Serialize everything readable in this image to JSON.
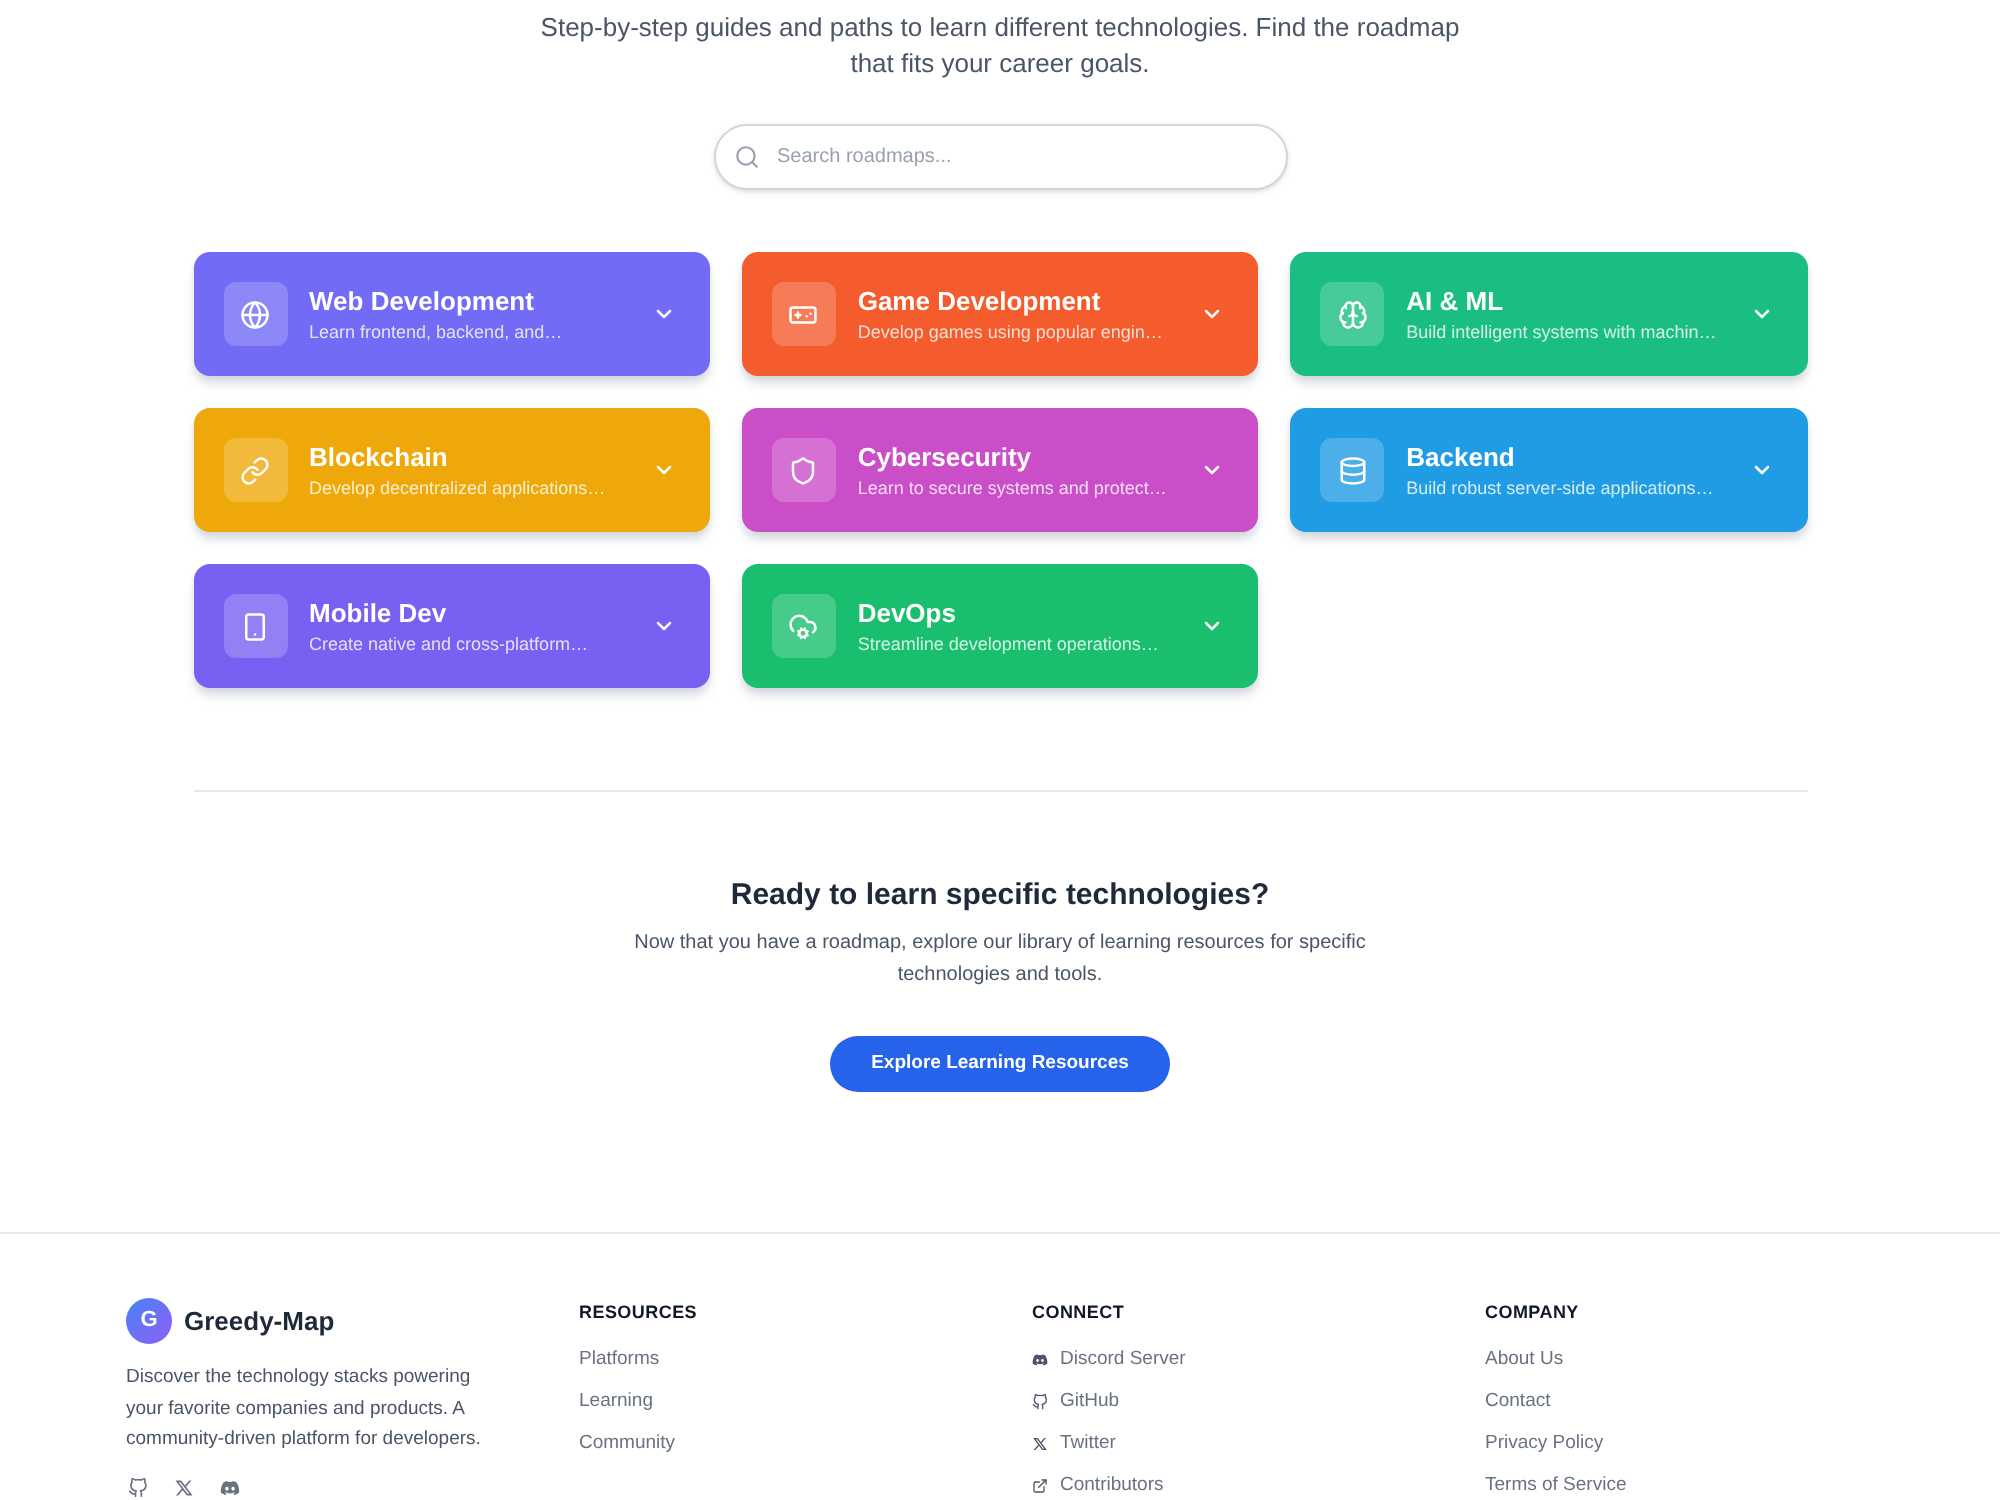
{
  "intro": {
    "text": "Step-by-step guides and paths to learn different technologies. Find the roadmap that fits your career goals."
  },
  "search": {
    "placeholder": "Search roadmaps..."
  },
  "roadmaps": [
    {
      "title": "Web Development",
      "description": "Learn frontend, backend, and…",
      "color": "#716bf6",
      "expanded": false
    },
    {
      "title": "Game Development",
      "description": "Develop games using popular engin…",
      "color": "#f45b2d",
      "expanded": false
    },
    {
      "title": "AI & ML",
      "description": "Build intelligent systems with machin…",
      "color": "#1bbe82",
      "expanded": false
    },
    {
      "title": "Blockchain",
      "description": "Develop decentralized applications…",
      "color": "#efa809",
      "expanded": false
    },
    {
      "title": "Cybersecurity",
      "description": "Learn to secure systems and protect…",
      "color": "#ca4ec8",
      "expanded": false
    },
    {
      "title": "Backend",
      "description": "Build robust server-side applications…",
      "color": "#209ce5",
      "expanded": false
    },
    {
      "title": "Mobile Dev",
      "description": "Create native and cross-platform…",
      "color": "#7761f3",
      "expanded": false
    },
    {
      "title": "DevOps",
      "description": "Streamline development operations…",
      "color": "#19bf6f",
      "expanded": false
    }
  ],
  "cta": {
    "heading": "Ready to learn specific technologies?",
    "text": "Now that you have a roadmap, explore our library of learning resources for specific technologies and tools.",
    "button": "Explore Learning Resources"
  },
  "footer": {
    "brand": {
      "logo_letter": "G",
      "name": "Greedy-Map",
      "description": "Discover the technology stacks powering your favorite companies and products. A community-driven platform for developers."
    },
    "columns": [
      {
        "heading": "RESOURCES",
        "kind": "plain",
        "links": [
          "Platforms",
          "Learning",
          "Community"
        ]
      },
      {
        "heading": "CONNECT",
        "kind": "with_icons",
        "links": [
          "Discord Server",
          "GitHub",
          "Twitter",
          "Contributors"
        ]
      },
      {
        "heading": "COMPANY",
        "kind": "plain",
        "links": [
          "About Us",
          "Contact",
          "Privacy Policy",
          "Terms of Service"
        ]
      }
    ]
  }
}
